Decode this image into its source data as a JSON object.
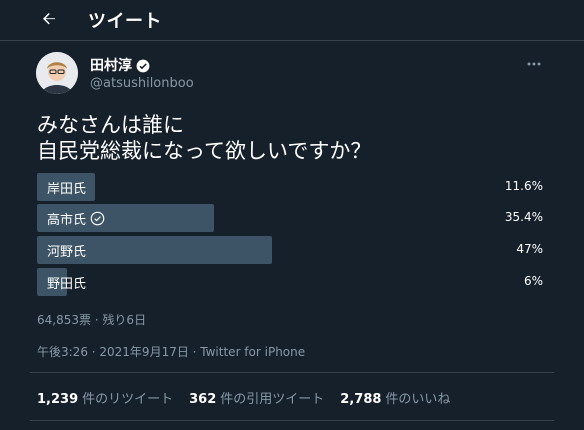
{
  "header": {
    "title": "ツイート"
  },
  "author": {
    "name": "田村淳",
    "handle": "@atsushilonboo"
  },
  "tweet": {
    "lines": [
      "みなさんは誰に",
      "自民党総裁になって欲しいですか？"
    ]
  },
  "poll": {
    "options": [
      {
        "label": "岸田氏",
        "percent_text": "11.6%",
        "percent": 11.6,
        "selected": false
      },
      {
        "label": "高市氏",
        "percent_text": "35.4%",
        "percent": 35.4,
        "selected": true
      },
      {
        "label": "河野氏",
        "percent_text": "47%",
        "percent": 47,
        "selected": false
      },
      {
        "label": "野田氏",
        "percent_text": "6%",
        "percent": 6,
        "selected": false
      }
    ],
    "summary": "64,853票 · 残り6日"
  },
  "meta": "午後3:26 · 2021年9月17日 · Twitter for iPhone",
  "stats": [
    {
      "count": "1,239",
      "label": "件のリツイート"
    },
    {
      "count": "362",
      "label": "件の引用ツイート"
    },
    {
      "count": "2,788",
      "label": "件のいいね"
    }
  ],
  "colors": {
    "background": "#15202b",
    "bar": "#3d5466",
    "muted": "#8899a6",
    "divider": "#38444d"
  }
}
